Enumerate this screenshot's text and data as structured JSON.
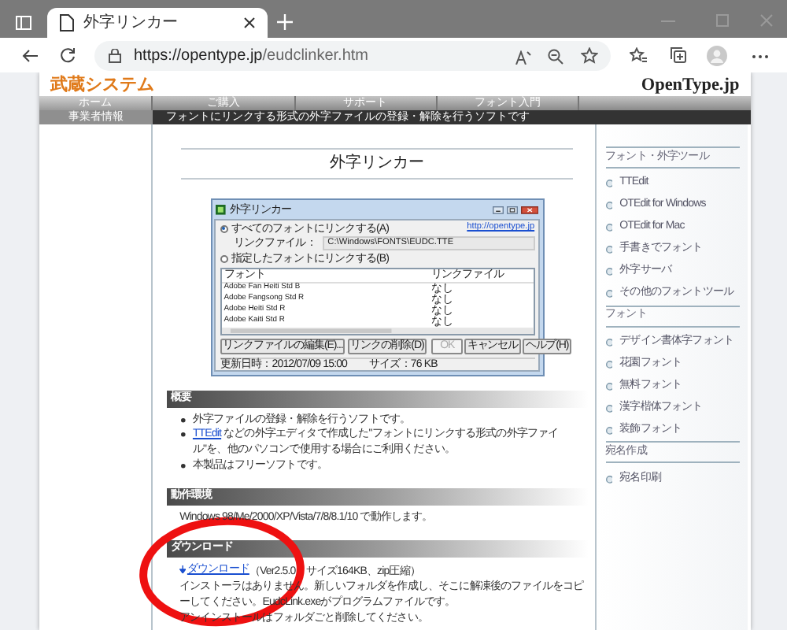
{
  "browser": {
    "tab_title": "外字リンカー",
    "url_host": "https://opentype.jp",
    "url_path": "/eudclinker.htm"
  },
  "site": {
    "logo": "武蔵システム",
    "brand": "OpenType.jp",
    "nav": [
      {
        "label": "ホーム",
        "selected": true
      },
      {
        "label": "ご購入",
        "selected": false
      },
      {
        "label": "サポート",
        "selected": false
      },
      {
        "label": "フォント入門",
        "selected": false
      }
    ],
    "subnav": "事業者情報",
    "tagline": "フォントにリンクする形式の外字ファイルの登録・解除を行うソフトです"
  },
  "main": {
    "title": "外字リンカー",
    "dialog": {
      "title": "外字リンカー",
      "link": "http://opentype.jp",
      "options": [
        {
          "label": "すべてのフォントにリンクする(A)",
          "checked": true
        },
        {
          "label": "指定したフォントにリンクする(B)",
          "checked": false
        }
      ],
      "link_file_label": "リンクファイル：",
      "link_file": "C:\\Windows\\FONTS\\EUDC.TTE",
      "columns": [
        "フォント",
        "リンクファイル"
      ],
      "rows": [
        [
          "Adobe Fan Heiti Std B",
          "なし"
        ],
        [
          "Adobe Fangsong Std R",
          "なし"
        ],
        [
          "Adobe Heiti Std R",
          "なし"
        ],
        [
          "Adobe Kaiti Std R",
          "なし"
        ]
      ],
      "buttons": [
        {
          "label": "リンクファイルの編集(E)...",
          "disabled": false
        },
        {
          "label": "リンクの削除(D)",
          "disabled": false
        },
        {
          "label": "OK",
          "disabled": true
        },
        {
          "label": "キャンセル",
          "disabled": false
        },
        {
          "label": "ヘルプ(H)",
          "disabled": false
        }
      ],
      "status": [
        "更新日時：2012/07/09 15:00",
        "サイズ：76 KB"
      ]
    },
    "sections": [
      {
        "heading": "概要",
        "kind": "bullets",
        "items": [
          [
            {
              "text": "外字ファイルの登録・解除を行うソフトです。"
            }
          ],
          [
            {
              "link": "TTEdit"
            },
            {
              "text": " などの外字エディタで作成した\"フォントにリンクする形式の外字ファイル\"を、他のパソコンで使用する場合にご利用ください。"
            }
          ],
          [
            {
              "text": "本製品はフリーソフトです。"
            }
          ]
        ]
      },
      {
        "heading": "動作環境",
        "kind": "text",
        "lines": [
          [
            {
              "text": "Windows 98/Me/2000/XP/Vista/7/8/8.1/10 で動作します。"
            }
          ]
        ]
      },
      {
        "heading": "ダウンロード",
        "kind": "text",
        "lines": [
          [
            {
              "download": "ダウンロード"
            },
            {
              "text": "（Ver2.5.0　サイズ164KB、zip圧縮）"
            }
          ],
          [
            {
              "text": "インストーラはありません。新しいフォルダを作成し、そこに解凍後のファイルをコピーしてください。EudcLink.exeがプログラムファイルです。"
            }
          ],
          [
            {
              "text": "アンインストールはフォルダごと削除してください。"
            }
          ]
        ]
      }
    ]
  },
  "sidebar": [
    {
      "heading": "フォント・外字ツール",
      "items": [
        "TTEdit",
        "OTEdit for Windows",
        "OTEdit for Mac",
        "手書きでフォント",
        "外字サーバ",
        "その他のフォントツール"
      ]
    },
    {
      "heading": "フォント",
      "items": [
        "デザイン書体字フォント",
        "花園フォント",
        "無料フォント",
        "漢字楷体フォント",
        "装飾フォント"
      ]
    },
    {
      "heading": "宛名作成",
      "items": [
        "宛名印刷"
      ]
    }
  ]
}
